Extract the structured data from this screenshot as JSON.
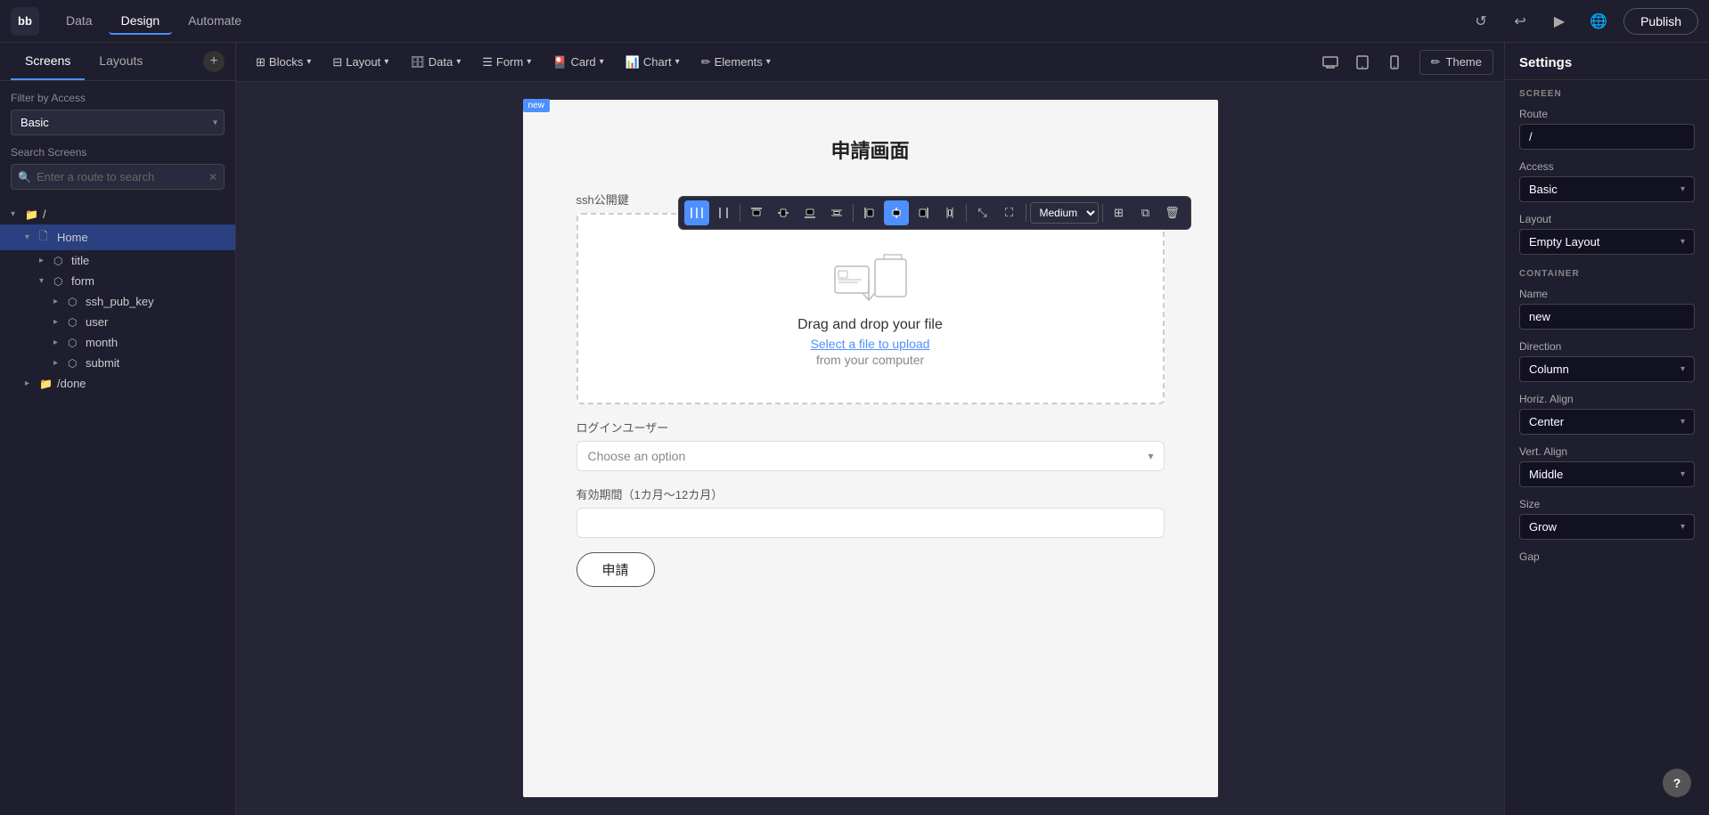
{
  "app": {
    "logo": "bb",
    "nav_tabs": [
      "Data",
      "Design",
      "Automate"
    ],
    "active_tab": "Design",
    "publish_label": "Publish"
  },
  "top_actions": {
    "refresh_icon": "↺",
    "undo_icon": "↩",
    "play_icon": "▶",
    "globe_icon": "🌐"
  },
  "left_sidebar": {
    "tabs": [
      "Screens",
      "Layouts"
    ],
    "active_tab": "Screens",
    "add_icon": "+",
    "filter_label": "Filter by Access",
    "filter_value": "Basic",
    "search_label": "Search Screens",
    "search_placeholder": "Enter a route to search",
    "tree": [
      {
        "level": 0,
        "label": "/",
        "type": "folder",
        "expanded": true,
        "arrow": "▾"
      },
      {
        "level": 1,
        "label": "Home",
        "type": "folder",
        "expanded": true,
        "arrow": "▾"
      },
      {
        "level": 2,
        "label": "title",
        "type": "component",
        "arrow": "▸"
      },
      {
        "level": 2,
        "label": "form",
        "type": "folder",
        "expanded": true,
        "arrow": "▾"
      },
      {
        "level": 3,
        "label": "ssh_pub_key",
        "type": "component",
        "arrow": "▸"
      },
      {
        "level": 3,
        "label": "user",
        "type": "component",
        "arrow": "▸"
      },
      {
        "level": 3,
        "label": "month",
        "type": "component",
        "arrow": "▸"
      },
      {
        "level": 3,
        "label": "submit",
        "type": "component",
        "arrow": "▸"
      },
      {
        "level": 1,
        "label": "/done",
        "type": "folder",
        "arrow": "▸"
      }
    ]
  },
  "toolbar": {
    "blocks_label": "Blocks",
    "layout_label": "Layout",
    "data_label": "Data",
    "form_label": "Form",
    "card_label": "Card",
    "chart_label": "Chart",
    "elements_label": "Elements",
    "dropdown_icon": "▾",
    "device_desktop_icon": "🖥",
    "device_tablet_icon": "▭",
    "device_mobile_icon": "📱",
    "theme_label": "Theme",
    "theme_icon": "✏"
  },
  "float_toolbar": {
    "col3_icon": "⋮⋮⋮",
    "col2_icon": "⋮⋮",
    "align_top_icon": "⬆",
    "align_center_v_icon": "↕",
    "align_bottom_icon": "⬇",
    "distribute_icon": "⇔",
    "align_left_icon": "◁",
    "align_center_h_icon": "⊡",
    "align_right_icon": "▷",
    "align_top2_icon": "△",
    "expand_icon": "⤡",
    "fullscreen_icon": "⛶",
    "medium_label": "Medium",
    "grid_icon": "⊞",
    "copy_icon": "⧉",
    "delete_icon": "🗑"
  },
  "canvas": {
    "new_badge": "new",
    "title": "申請画面",
    "ssh_label": "ssh公開鍵",
    "drop_main_text": "Drag and drop your file",
    "drop_link_text": "Select a file to upload",
    "drop_sub_text": "from your computer",
    "login_user_label": "ログインユーザー",
    "select_placeholder": "Choose an option",
    "validity_label": "有効期間（1カ月〜12カ月）",
    "submit_label": "申請"
  },
  "right_panel": {
    "title": "Settings",
    "screen_section": "SCREEN",
    "route_label": "Route",
    "route_value": "/",
    "access_label": "Access",
    "access_value": "Basic",
    "layout_label": "Layout",
    "layout_value": "Empty Layout",
    "container_section": "CONTAINER",
    "name_label": "Name",
    "name_value": "new",
    "direction_label": "Direction",
    "direction_value": "Column",
    "horiz_align_label": "Horiz. Align",
    "horiz_align_value": "Center",
    "vert_align_label": "Vert. Align",
    "vert_align_value": "Middle",
    "size_label": "Size",
    "size_value": "Grow",
    "gap_label": "Gap",
    "dropdown_arrow": "▾"
  },
  "help": {
    "icon": "?"
  }
}
